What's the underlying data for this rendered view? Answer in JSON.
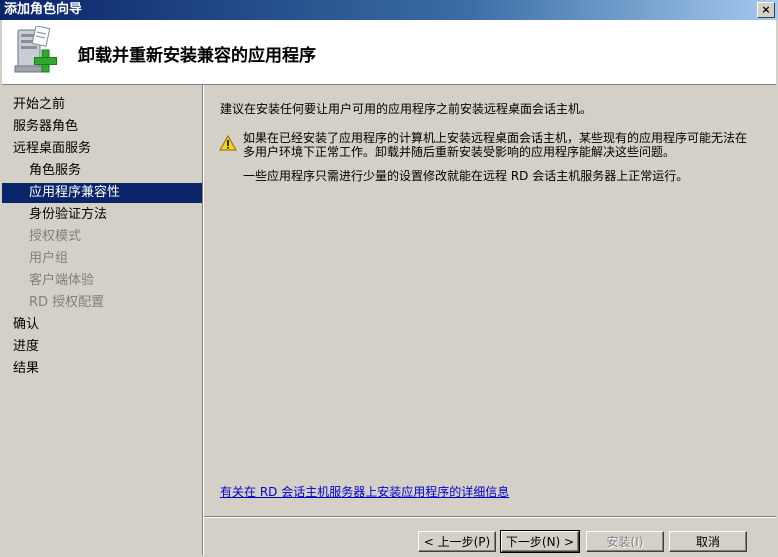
{
  "window": {
    "title": "添加角色向导",
    "close_label": "×"
  },
  "header": {
    "title": "卸载并重新安装兼容的应用程序",
    "icon": "server-add-icon"
  },
  "sidebar": {
    "items": [
      {
        "label": "开始之前",
        "level": 1,
        "state": "normal"
      },
      {
        "label": "服务器角色",
        "level": 1,
        "state": "normal"
      },
      {
        "label": "远程桌面服务",
        "level": 1,
        "state": "normal"
      },
      {
        "label": "角色服务",
        "level": 2,
        "state": "normal"
      },
      {
        "label": "应用程序兼容性",
        "level": 2,
        "state": "selected"
      },
      {
        "label": "身份验证方法",
        "level": 2,
        "state": "normal"
      },
      {
        "label": "授权模式",
        "level": 2,
        "state": "disabled"
      },
      {
        "label": "用户组",
        "level": 2,
        "state": "disabled"
      },
      {
        "label": "客户端体验",
        "level": 2,
        "state": "disabled"
      },
      {
        "label": "RD 授权配置",
        "level": 2,
        "state": "disabled"
      },
      {
        "label": "确认",
        "level": 1,
        "state": "normal"
      },
      {
        "label": "进度",
        "level": 1,
        "state": "normal"
      },
      {
        "label": "结果",
        "level": 1,
        "state": "normal"
      }
    ]
  },
  "content": {
    "intro": "建议在安装任何要让用户可用的应用程序之前安装远程桌面会话主机。",
    "warning_line1": "如果在已经安装了应用程序的计算机上安装远程桌面会话主机，某些现有的应用程序可能无法在",
    "warning_line2": "多用户环境下正常工作。卸载并随后重新安装受影响的应用程序能解决这些问题。",
    "note": "一些应用程序只需进行少量的设置修改就能在远程 RD 会话主机服务器上正常运行。",
    "link": "有关在 RD 会话主机服务器上安装应用程序的详细信息",
    "warning_icon": "warning-icon"
  },
  "buttons": {
    "back": "< 上一步(P)",
    "next": "下一步(N) >",
    "install": "安装(I)",
    "cancel": "取消"
  }
}
